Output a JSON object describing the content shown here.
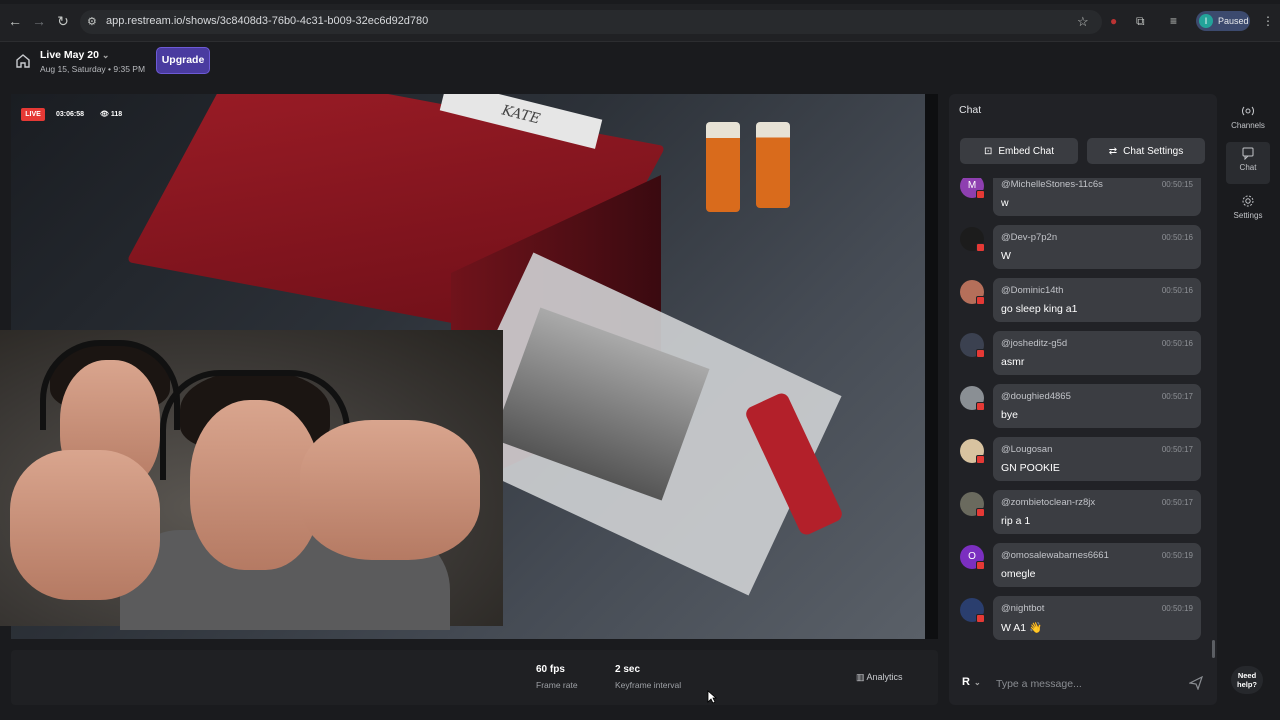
{
  "browser": {
    "url": "app.restream.io/shows/3c8408d3-76b0-4c31-b009-32ec6d92d780",
    "profile_initial": "I",
    "profile_status": "Paused"
  },
  "header": {
    "title": "Live May 20",
    "subtitle": "Aug 15, Saturday • 9:35 PM",
    "upgrade_label": "Upgrade"
  },
  "stream": {
    "live_label": "LIVE",
    "timer": "03:06:58",
    "viewers": "118",
    "book_label": "KATE",
    "stats": [
      {
        "value": "60 fps",
        "label": "Frame rate"
      },
      {
        "value": "2 sec",
        "label": "Keyframe interval"
      }
    ],
    "analytics_label": "Analytics"
  },
  "chat": {
    "title": "Chat",
    "embed_label": "Embed Chat",
    "settings_label": "Chat Settings",
    "placeholder": "Type a message...",
    "composer_initial": "R",
    "messages": [
      {
        "user": "@MichelleStones-11c6s",
        "time": "00:50:15",
        "text": "w",
        "avatar_color": "#8e3fb0",
        "avatar_letter": "M"
      },
      {
        "user": "@Dev-p7p2n",
        "time": "00:50:16",
        "text": "W",
        "avatar_color": "#1c1c1c",
        "avatar_letter": ""
      },
      {
        "user": "@Dominic14th",
        "time": "00:50:16",
        "text": "go sleep king a1",
        "avatar_color": "#b56f5a",
        "avatar_letter": ""
      },
      {
        "user": "@josheditz-g5d",
        "time": "00:50:16",
        "text": "asmr",
        "avatar_color": "#3b4150",
        "avatar_letter": ""
      },
      {
        "user": "@doughied4865",
        "time": "00:50:17",
        "text": "bye",
        "avatar_color": "#8a8f94",
        "avatar_letter": ""
      },
      {
        "user": "@Lougosan",
        "time": "00:50:17",
        "text": "GN POOKIE",
        "avatar_color": "#d8c3a0",
        "avatar_letter": ""
      },
      {
        "user": "@zombietoclean-rz8jx",
        "time": "00:50:17",
        "text": "rip a 1",
        "avatar_color": "#6a6a5e",
        "avatar_letter": ""
      },
      {
        "user": "@omosalewabarnes6661",
        "time": "00:50:19",
        "text": "omegle",
        "avatar_color": "#7b2fc0",
        "avatar_letter": "O"
      },
      {
        "user": "@nightbot",
        "time": "00:50:19",
        "text": "W A1 👋",
        "avatar_color": "#2a3e6e",
        "avatar_letter": ""
      }
    ]
  },
  "rail": {
    "items": [
      {
        "label": "Channels"
      },
      {
        "label": "Chat"
      },
      {
        "label": "Settings"
      }
    ],
    "help_label": "Need help?"
  }
}
